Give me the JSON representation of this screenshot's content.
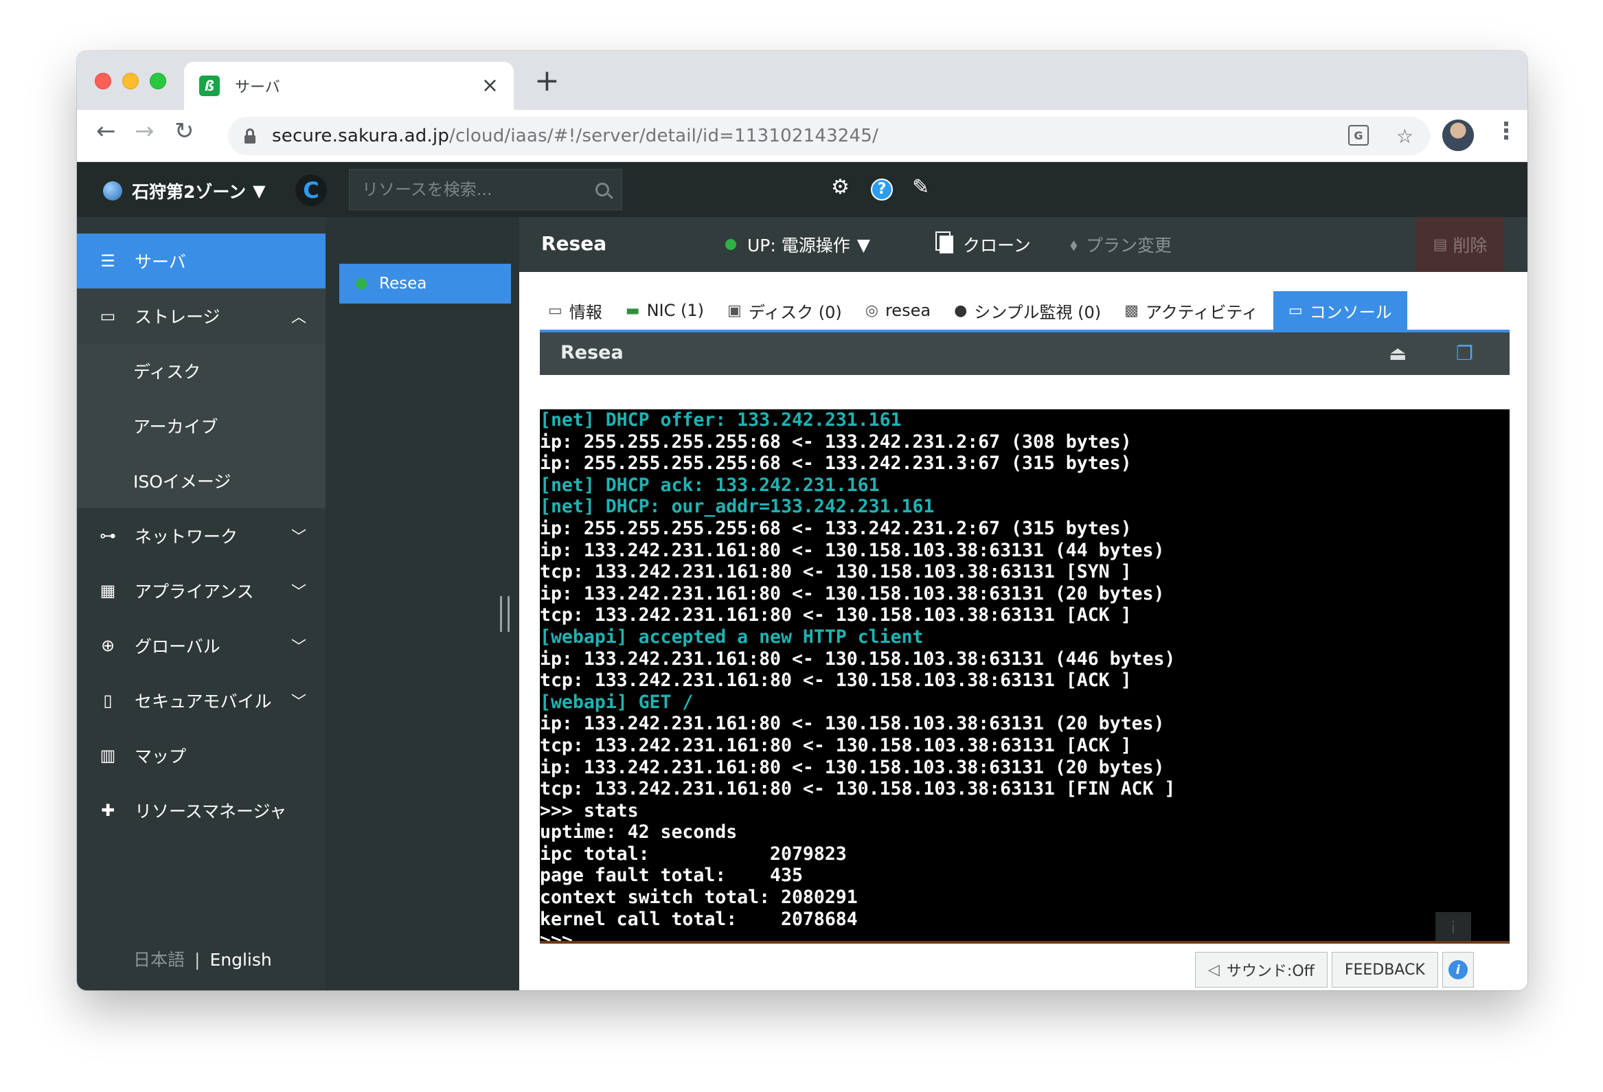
{
  "browser": {
    "tab_title": "サーバ",
    "tab_favicon": "sakura-logo",
    "url_host": "secure.sakura.ad.jp",
    "url_path": "/cloud/iaas/#!/server/detail/id=113102143245/"
  },
  "header": {
    "zone_label": "石狩第2ゾーン",
    "search_placeholder": "リソースを検索..."
  },
  "sidebar": {
    "items": [
      {
        "label": "サーバ",
        "icon": "server-icon",
        "active": true
      },
      {
        "label": "ストレージ",
        "icon": "storage-icon",
        "expanded": true
      },
      {
        "label": "ディスク"
      },
      {
        "label": "アーカイブ"
      },
      {
        "label": "ISOイメージ"
      },
      {
        "label": "ネットワーク",
        "icon": "network-icon"
      },
      {
        "label": "アプライアンス",
        "icon": "appliance-icon"
      },
      {
        "label": "グローバル",
        "icon": "globe-icon"
      },
      {
        "label": "セキュアモバイル",
        "icon": "mobile-icon"
      },
      {
        "label": "マップ",
        "icon": "map-icon"
      },
      {
        "label": "リソースマネージャ",
        "icon": "puzzle-icon"
      }
    ],
    "lang_ja": "日本語",
    "lang_sep": "|",
    "lang_en": "English"
  },
  "server_list": {
    "items": [
      {
        "name": "Resea",
        "status": "up"
      }
    ]
  },
  "detail": {
    "title": "Resea",
    "power_label": "UP: 電源操作",
    "clone_label": "クローン",
    "plan_label": "プラン変更",
    "delete_label": "削除",
    "tabs": [
      {
        "label": "情報"
      },
      {
        "label": "NIC (1)"
      },
      {
        "label": "ディスク (0)"
      },
      {
        "label": "resea"
      },
      {
        "label": "シンプル監視 (0)"
      },
      {
        "label": "アクティビティ"
      },
      {
        "label": "コンソール",
        "active": true
      }
    ],
    "console_title": "Resea"
  },
  "terminal": {
    "lines": [
      {
        "text": "[net] DHCP offer: 133.242.231.161",
        "cyan": true
      },
      {
        "text": "ip: 255.255.255.255:68 <- 133.242.231.2:67 (308 bytes)",
        "cyan": false
      },
      {
        "text": "ip: 255.255.255.255:68 <- 133.242.231.3:67 (315 bytes)",
        "cyan": false
      },
      {
        "text": "[net] DHCP ack: 133.242.231.161",
        "cyan": true
      },
      {
        "text": "[net] DHCP: our_addr=133.242.231.161",
        "cyan": true
      },
      {
        "text": "ip: 255.255.255.255:68 <- 133.242.231.2:67 (315 bytes)",
        "cyan": false
      },
      {
        "text": "ip: 133.242.231.161:80 <- 130.158.103.38:63131 (44 bytes)",
        "cyan": false
      },
      {
        "text": "tcp: 133.242.231.161:80 <- 130.158.103.38:63131 [SYN ]",
        "cyan": false
      },
      {
        "text": "ip: 133.242.231.161:80 <- 130.158.103.38:63131 (20 bytes)",
        "cyan": false
      },
      {
        "text": "tcp: 133.242.231.161:80 <- 130.158.103.38:63131 [ACK ]",
        "cyan": false
      },
      {
        "text": "[webapi] accepted a new HTTP client",
        "cyan": true
      },
      {
        "text": "ip: 133.242.231.161:80 <- 130.158.103.38:63131 (446 bytes)",
        "cyan": false
      },
      {
        "text": "tcp: 133.242.231.161:80 <- 130.158.103.38:63131 [ACK ]",
        "cyan": false
      },
      {
        "text": "[webapi] GET /",
        "cyan": true
      },
      {
        "text": "ip: 133.242.231.161:80 <- 130.158.103.38:63131 (20 bytes)",
        "cyan": false
      },
      {
        "text": "tcp: 133.242.231.161:80 <- 130.158.103.38:63131 [ACK ]",
        "cyan": false
      },
      {
        "text": "ip: 133.242.231.161:80 <- 130.158.103.38:63131 (20 bytes)",
        "cyan": false
      },
      {
        "text": "tcp: 133.242.231.161:80 <- 130.158.103.38:63131 [FIN ACK ]",
        "cyan": false
      },
      {
        "text": ">>> stats",
        "cyan": false
      },
      {
        "text": "uptime: 42 seconds",
        "cyan": false
      },
      {
        "text": "ipc total:           2079823",
        "cyan": false
      },
      {
        "text": "page fault total:    435",
        "cyan": false
      },
      {
        "text": "context switch total: 2080291",
        "cyan": false
      },
      {
        "text": "kernel call total:    2078684",
        "cyan": false
      },
      {
        "text": ">>>",
        "cyan": false
      }
    ]
  },
  "footer": {
    "sound_label": "サウンド:Off",
    "feedback_label": "FEEDBACK"
  },
  "colors": {
    "accent": "#3a8ee6",
    "status_up": "#2fb344",
    "terminal_cyan": "#1fb3b3"
  }
}
